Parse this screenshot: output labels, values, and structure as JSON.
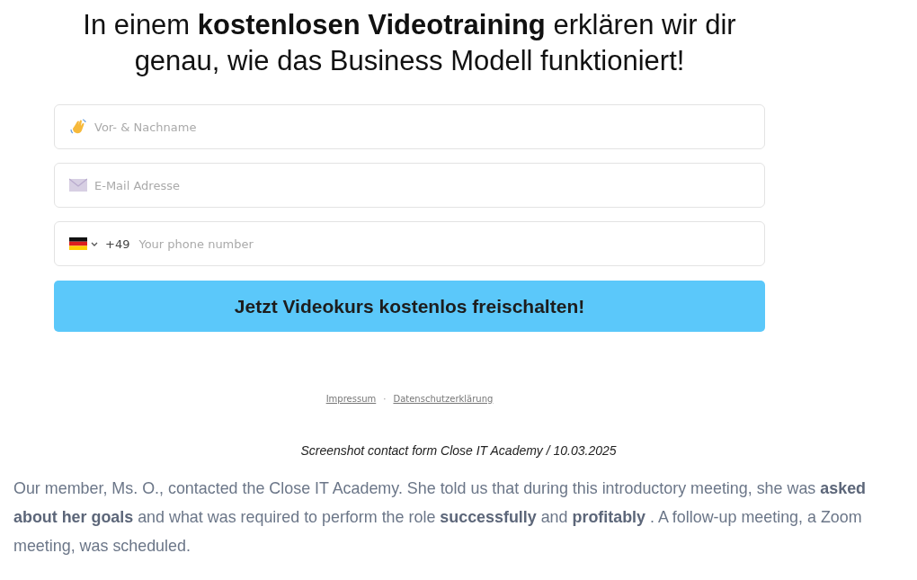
{
  "heading": "In einem **kostenlosen Videotraining** erklären wir dir genau, wie das Business Modell funktioniert!",
  "fields": [
    {
      "kind": "name",
      "placeholder": "Vor- & Nachname"
    },
    {
      "kind": "email",
      "placeholder": "E-Mail Adresse"
    },
    {
      "kind": "phone",
      "dial_code": "+49",
      "placeholder": "Your phone number"
    }
  ],
  "submit_button": "Jetzt Videokurs kostenlos freischalten!",
  "footer_links": [
    "Impressum",
    "Datenschutzerklärung"
  ],
  "footer_separator": "·",
  "caption": "Screenshot contact form Close IT Academy / 10.03.2025",
  "paragraph": "Our member, Ms. O., contacted the Close IT Academy. She told us that during this introductory meeting, she was **asked about her goals** and what was required to perform the role **successfully** and **profitably** . A follow-up meeting, a Zoom meeting, was scheduled."
}
